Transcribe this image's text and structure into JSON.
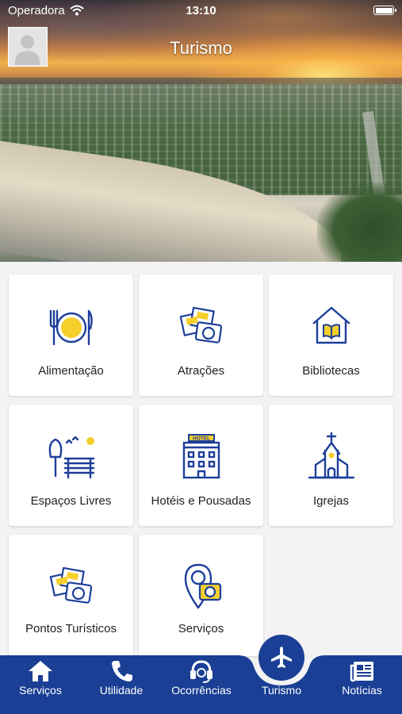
{
  "status_bar": {
    "carrier": "Operadora",
    "time": "13:10"
  },
  "header": {
    "title": "Turismo"
  },
  "categories": [
    {
      "label": "Alimentação",
      "icon": "plate-cutlery-icon"
    },
    {
      "label": "Atrações",
      "icon": "photos-camera-icon"
    },
    {
      "label": "Bibliotecas",
      "icon": "library-book-icon"
    },
    {
      "label": "Espaços Livres",
      "icon": "park-bench-icon"
    },
    {
      "label": "Hotéis e Pousadas",
      "icon": "hotel-icon"
    },
    {
      "label": "Igrejas",
      "icon": "church-icon"
    },
    {
      "label": "Pontos Turísticos",
      "icon": "photos-camera-icon"
    },
    {
      "label": "Serviços",
      "icon": "location-camera-icon"
    }
  ],
  "hotel_sign": "HOTEL",
  "bottom_nav": {
    "items": [
      {
        "label": "Serviços",
        "icon": "home-icon"
      },
      {
        "label": "Utilidade",
        "icon": "phone-icon"
      },
      {
        "label": "Ocorrências",
        "icon": "headset-icon"
      },
      {
        "label": "Turismo",
        "icon": "airplane-icon",
        "active": true
      },
      {
        "label": "Notícias",
        "icon": "newspaper-icon"
      }
    ]
  },
  "colors": {
    "primary_blue": "#1a3f95",
    "icon_blue": "#1d3f9a",
    "icon_yellow": "#f5cf2a",
    "card_bg": "#ffffff",
    "page_bg": "#f3f3f3"
  }
}
